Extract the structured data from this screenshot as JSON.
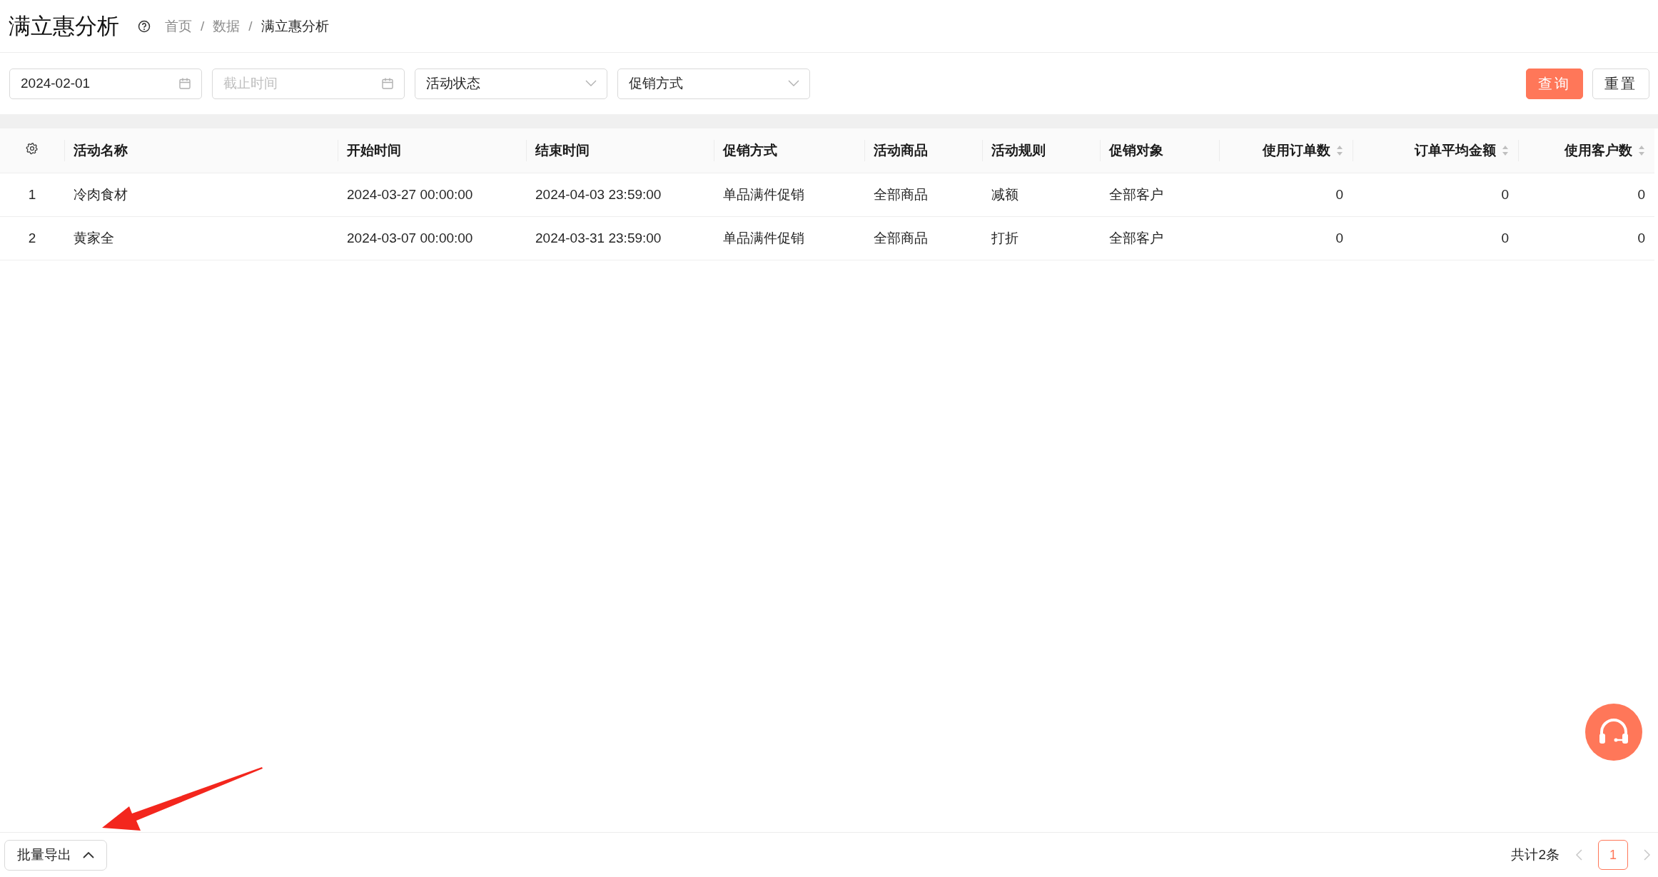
{
  "page_title": "满立惠分析",
  "breadcrumb": [
    {
      "label": "首页",
      "current": false
    },
    {
      "separator": "/",
      "label": "数据",
      "current": false
    },
    {
      "separator": "/",
      "label": "满立惠分析",
      "current": true
    }
  ],
  "filters": [
    {
      "kind": "date",
      "value": "2024-02-01"
    },
    {
      "kind": "date",
      "placeholder": "截止时间"
    },
    {
      "kind": "select",
      "value": "活动状态"
    },
    {
      "kind": "select",
      "value": "促销方式"
    }
  ],
  "actions": [
    {
      "label": "查询",
      "primary": true
    },
    {
      "label": "重置",
      "primary": false
    }
  ],
  "table": {
    "columns": [
      {
        "label": "活动名称",
        "sortable": false
      },
      {
        "label": "开始时间",
        "sortable": false
      },
      {
        "label": "结束时间",
        "sortable": false
      },
      {
        "label": "促销方式",
        "sortable": false
      },
      {
        "label": "活动商品",
        "sortable": false
      },
      {
        "label": "活动规则",
        "sortable": false
      },
      {
        "label": "促销对象",
        "sortable": false
      },
      {
        "label": "使用订单数",
        "sortable": true
      },
      {
        "label": "订单平均金额",
        "sortable": true
      },
      {
        "label": "使用客户数",
        "sortable": true
      }
    ],
    "rows": [
      {
        "index": "1",
        "cells": [
          "冷肉食材",
          "2024-03-27 00:00:00",
          "2024-04-03 23:59:00",
          "单品满件促销",
          "全部商品",
          "减额",
          "全部客户",
          "0",
          "0",
          "0"
        ]
      },
      {
        "index": "2",
        "cells": [
          "黄家全",
          "2024-03-07 00:00:00",
          "2024-03-31 23:59:00",
          "单品满件促销",
          "全部商品",
          "打折",
          "全部客户",
          "0",
          "0",
          "0"
        ]
      }
    ]
  },
  "footer": {
    "export_button": "批量导出",
    "total": "共计2条",
    "pages": [
      {
        "label": "1",
        "selected": true
      }
    ]
  }
}
